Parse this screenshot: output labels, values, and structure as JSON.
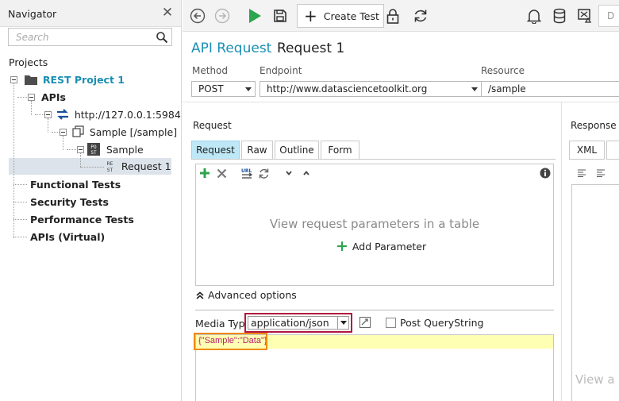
{
  "navigator": {
    "title": "Navigator",
    "search_placeholder": "Search",
    "projects_label": "Projects",
    "tree": {
      "project": "REST Project 1",
      "apis": "APIs",
      "service": "http://127.0.0.1:5984",
      "resource": "Sample [/sample]",
      "method": "Sample",
      "request": "Request 1",
      "functional": "Functional Tests",
      "security": "Security Tests",
      "performance": "Performance Tests",
      "virtual": "APIs (Virtual)"
    }
  },
  "toolbar": {
    "create_test": "Create Test",
    "clipped_label": "D"
  },
  "editor": {
    "title_type": "API Request",
    "title_name": "Request 1",
    "method_label": "Method",
    "method_value": "POST",
    "endpoint_label": "Endpoint",
    "endpoint_value": "http://www.datasciencetoolkit.org",
    "resource_label": "Resource",
    "resource_value": "/sample"
  },
  "request_panel": {
    "label": "Request",
    "tabs": [
      "Request",
      "Raw",
      "Outline",
      "Form"
    ],
    "active_tab": "Request",
    "empty_message": "View request parameters in a table",
    "add_parameter": "Add Parameter",
    "advanced_options": "Advanced options",
    "media_type_label": "Media Type",
    "media_type_value": "application/json",
    "post_querystring": "Post QueryString",
    "body": "{\"Sample\":\"Data\"}"
  },
  "response_panel": {
    "label": "Response",
    "tab": "XML",
    "view_text": "View a"
  },
  "colors": {
    "accent": "#1c8fb3",
    "active_tab": "#bfe8f7",
    "media_highlight": "#b0163d",
    "body_highlight": "#ef8a17",
    "run": "#2da44e"
  }
}
